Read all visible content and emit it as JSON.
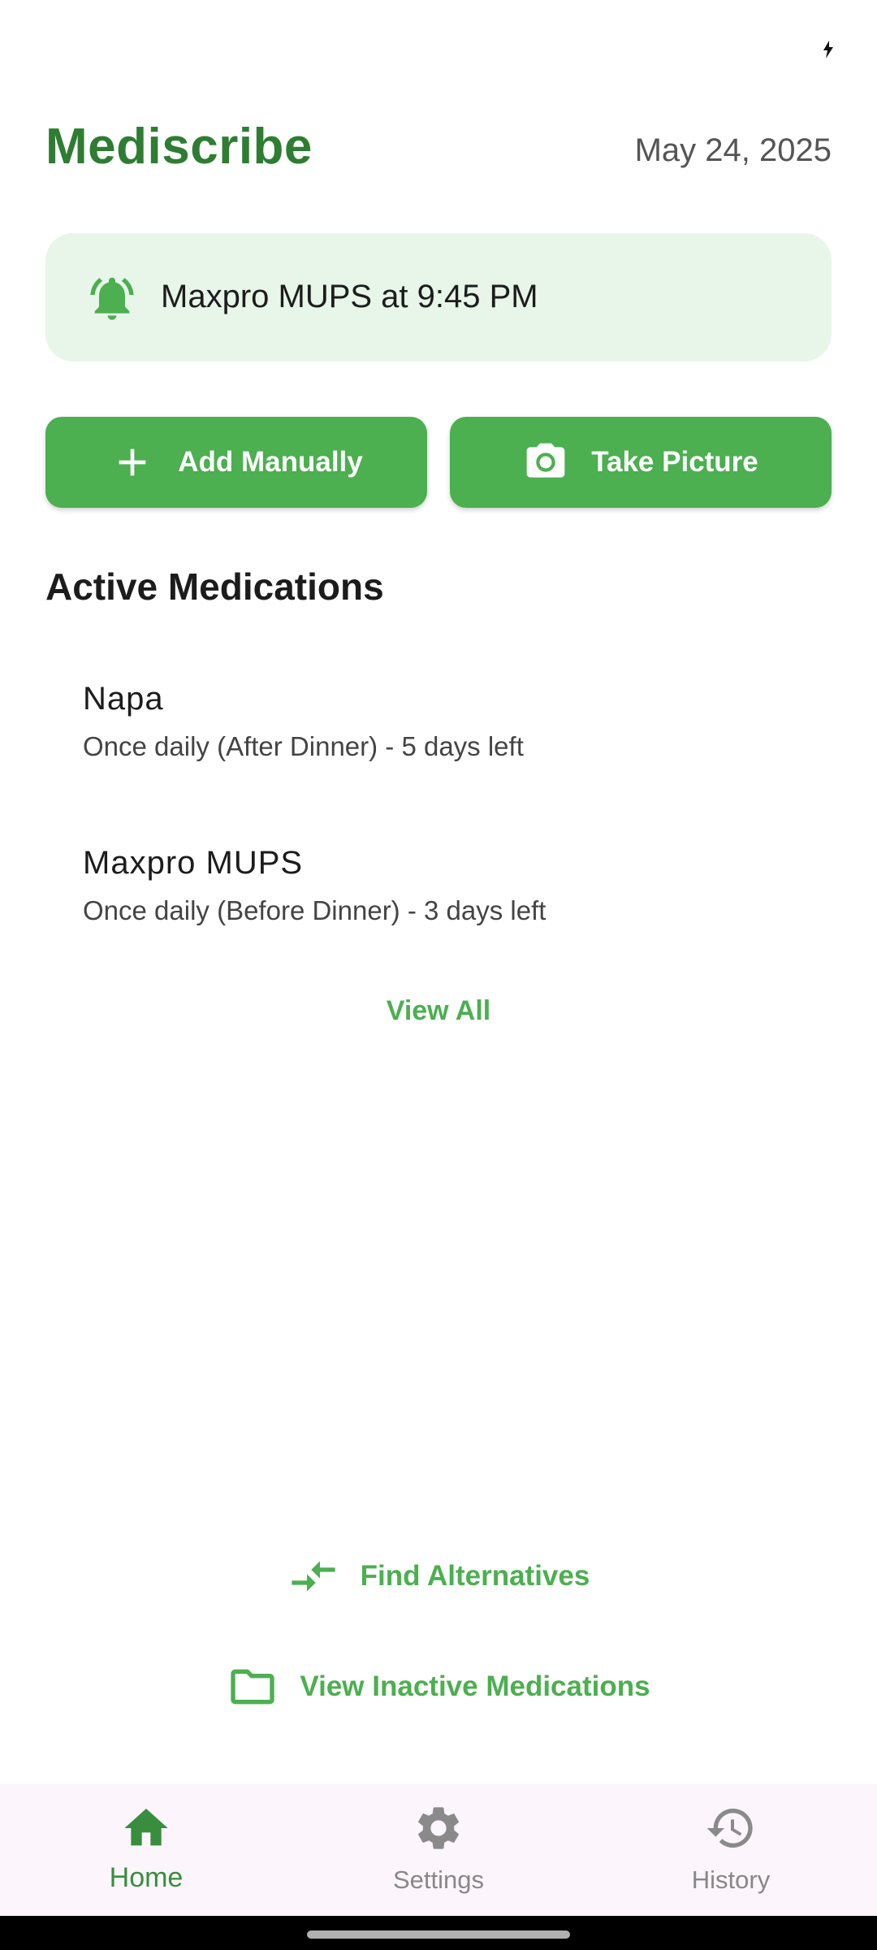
{
  "app": {
    "title": "Mediscribe",
    "date": "May 24, 2025",
    "accent_color": "#4caf50",
    "title_color": "#2e7d32"
  },
  "status_bar": {
    "icon": "charging-icon"
  },
  "reminder": {
    "icon": "bell-icon",
    "text": "Maxpro MUPS at 9:45 PM"
  },
  "actions": {
    "add_manually": {
      "label": "Add Manually",
      "icon": "plus-icon"
    },
    "take_picture": {
      "label": "Take Picture",
      "icon": "camera-icon"
    }
  },
  "active_medications": {
    "heading": "Active Medications",
    "items": [
      {
        "name": "Napa",
        "schedule": "Once daily (After Dinner) - 5 days left"
      },
      {
        "name": "Maxpro MUPS",
        "schedule": "Once daily (Before Dinner) - 3 days left"
      }
    ],
    "view_all_label": "View All"
  },
  "links": {
    "find_alternatives": {
      "label": "Find Alternatives",
      "icon": "compare-arrows-icon"
    },
    "view_inactive": {
      "label": "View Inactive Medications",
      "icon": "folder-icon"
    }
  },
  "bottom_nav": {
    "items": [
      {
        "label": "Home",
        "icon": "home-icon",
        "selected": true
      },
      {
        "label": "Settings",
        "icon": "gear-icon",
        "selected": false
      },
      {
        "label": "History",
        "icon": "history-icon",
        "selected": false
      }
    ]
  }
}
